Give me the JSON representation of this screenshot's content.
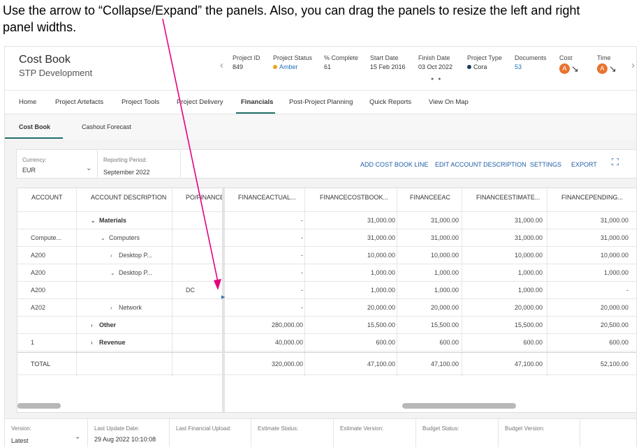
{
  "instruction": {
    "line1": "Use the arrow to “Collapse/Expand” the panels.  Also, you can drag the panels to resize the left and right",
    "line2": "panel widths."
  },
  "project": {
    "title": "Cost Book",
    "subtitle": "STP Development"
  },
  "meta": {
    "project_id": {
      "label": "Project ID",
      "value": "849"
    },
    "project_status": {
      "label": "Project Status",
      "value": "Amber",
      "color": "#f0a020"
    },
    "complete": {
      "label": "% Complete",
      "value": "61"
    },
    "start_date": {
      "label": "Start Date",
      "value": "15 Feb 2016"
    },
    "finish_date": {
      "label": "Finish Date",
      "value": "03 Oct 2022"
    },
    "project_type": {
      "label": "Project Type",
      "value": "Cora",
      "color": "#1e3a5f"
    },
    "documents": {
      "label": "Documents",
      "value": "53"
    },
    "cost": {
      "label": "Cost",
      "badge": "A"
    },
    "time": {
      "label": "Time",
      "badge": "A"
    },
    "prev_icon": "chevron-left-icon",
    "next_icon": "chevron-right-icon"
  },
  "nav": {
    "items": [
      "Home",
      "Project Artefacts",
      "Project Tools",
      "Project Delivery",
      "Financials",
      "Post-Project Planning",
      "Quick Reports",
      "View On Map"
    ],
    "active": "Financials"
  },
  "subtabs": {
    "items": [
      "Cost Book",
      "Cashout Forecast"
    ],
    "active": "Cost Book"
  },
  "filters": {
    "currency": {
      "label": "Currency:",
      "value": "EUR"
    },
    "period": {
      "label": "Reporting Period:",
      "value": "September 2022"
    },
    "actions": [
      "ADD COST BOOK LINE",
      "EDIT ACCOUNT DESCRIPTION",
      "SETTINGS",
      "EXPORT"
    ]
  },
  "table": {
    "left_headers": [
      "ACCOUNT",
      "ACCOUNT DESCRIPTION",
      "PO/FINANCE"
    ],
    "right_headers": [
      "FINANCEACTUAL...",
      "FINANCECOSTBOOK...",
      "FINANCEEAC",
      "FINANCEESTIMATE...",
      "FINANCEPENDING..."
    ],
    "rows": [
      {
        "account": "",
        "desc": "Materials",
        "caret": "⌄",
        "indent": 0,
        "bold": true,
        "po": "",
        "vals": [
          "-",
          "31,000.00",
          "31,000.00",
          "31,000.00",
          "31,000.00"
        ]
      },
      {
        "account": "Compute...",
        "desc": "Computers",
        "caret": "⌄",
        "indent": 1,
        "bold": false,
        "po": "",
        "vals": [
          "-",
          "31,000.00",
          "31,000.00",
          "31,000.00",
          "31,000.00"
        ]
      },
      {
        "account": "A200",
        "desc": "Desktop P...",
        "caret": "›",
        "indent": 2,
        "bold": false,
        "po": "",
        "vals": [
          "-",
          "10,000.00",
          "10,000.00",
          "10,000.00",
          "10,000.00"
        ]
      },
      {
        "account": "A200",
        "desc": "Desktop P...",
        "caret": "⌄",
        "indent": 2,
        "bold": false,
        "po": "",
        "vals": [
          "-",
          "1,000.00",
          "1,000.00",
          "1,000.00",
          "1,000.00"
        ]
      },
      {
        "account": "A200",
        "desc": "",
        "caret": "",
        "indent": 0,
        "bold": false,
        "po": "DC",
        "vals": [
          "-",
          "1,000.00",
          "1,000.00",
          "1,000.00",
          "-"
        ]
      },
      {
        "account": "A202",
        "desc": "Network",
        "caret": "›",
        "indent": 2,
        "bold": false,
        "po": "",
        "vals": [
          "-",
          "20,000.00",
          "20,000.00",
          "20,000.00",
          "20,000.00"
        ]
      },
      {
        "account": "",
        "desc": "Other",
        "caret": "›",
        "indent": 0,
        "bold": true,
        "po": "",
        "vals": [
          "280,000.00",
          "15,500.00",
          "15,500.00",
          "15,500.00",
          "20,500.00"
        ]
      },
      {
        "account": "1",
        "desc": "Revenue",
        "caret": "›",
        "indent": 0,
        "bold": true,
        "po": "",
        "vals": [
          "40,000.00",
          "600.00",
          "600.00",
          "600.00",
          "600.00"
        ]
      }
    ],
    "total": {
      "label": "TOTAL",
      "vals": [
        "320,000.00",
        "47,100.00",
        "47,100.00",
        "47,100.00",
        "52,100.00"
      ]
    }
  },
  "footer": {
    "version": {
      "label": "Version:",
      "value": "Latest"
    },
    "last_update": {
      "label": "Last Update Date:",
      "value": "29 Aug 2022 10:10:08"
    },
    "last_upload": {
      "label": "Last Financial Upload:",
      "value": ""
    },
    "estimate_status": {
      "label": "Estimate Status:",
      "value": ""
    },
    "estimate_version": {
      "label": "Estimate Version:",
      "value": ""
    },
    "budget_status": {
      "label": "Budget Status:",
      "value": ""
    },
    "budget_version": {
      "label": "Budget Version:",
      "value": ""
    }
  },
  "colors": {
    "accent": "#1f6f6a",
    "link": "#1f5fa5",
    "badge": "#e8722e",
    "annotation": "#e6007e"
  }
}
